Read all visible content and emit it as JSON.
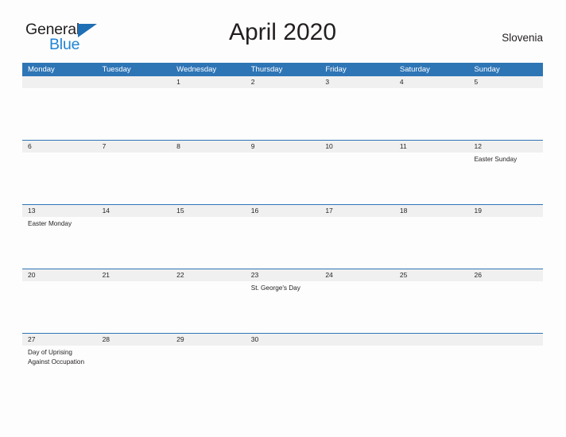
{
  "brand": {
    "name_part1": "General",
    "name_part2": "Blue",
    "flag_icon": "blue-flag-triangle",
    "color_dark": "#231f20",
    "color_blue": "#1f84d6"
  },
  "header": {
    "title": "April 2020",
    "country": "Slovenia"
  },
  "theme": {
    "header_blue": "#2e75b6",
    "number_band_gray": "#f0f0f0",
    "page_background": "#fdfdfd",
    "text": "#231f20"
  },
  "calendar": {
    "month": "April",
    "year": "2020",
    "weekday_headers": [
      "Monday",
      "Tuesday",
      "Wednesday",
      "Thursday",
      "Friday",
      "Saturday",
      "Sunday"
    ],
    "weeks": [
      {
        "days": [
          {
            "number": "",
            "event": ""
          },
          {
            "number": "",
            "event": ""
          },
          {
            "number": "1",
            "event": ""
          },
          {
            "number": "2",
            "event": ""
          },
          {
            "number": "3",
            "event": ""
          },
          {
            "number": "4",
            "event": ""
          },
          {
            "number": "5",
            "event": ""
          }
        ]
      },
      {
        "days": [
          {
            "number": "6",
            "event": ""
          },
          {
            "number": "7",
            "event": ""
          },
          {
            "number": "8",
            "event": ""
          },
          {
            "number": "9",
            "event": ""
          },
          {
            "number": "10",
            "event": ""
          },
          {
            "number": "11",
            "event": ""
          },
          {
            "number": "12",
            "event": "Easter Sunday"
          }
        ]
      },
      {
        "days": [
          {
            "number": "13",
            "event": "Easter Monday"
          },
          {
            "number": "14",
            "event": ""
          },
          {
            "number": "15",
            "event": ""
          },
          {
            "number": "16",
            "event": ""
          },
          {
            "number": "17",
            "event": ""
          },
          {
            "number": "18",
            "event": ""
          },
          {
            "number": "19",
            "event": ""
          }
        ]
      },
      {
        "days": [
          {
            "number": "20",
            "event": ""
          },
          {
            "number": "21",
            "event": ""
          },
          {
            "number": "22",
            "event": ""
          },
          {
            "number": "23",
            "event": "St. George's Day"
          },
          {
            "number": "24",
            "event": ""
          },
          {
            "number": "25",
            "event": ""
          },
          {
            "number": "26",
            "event": ""
          }
        ]
      },
      {
        "days": [
          {
            "number": "27",
            "event": "Day of Uprising\nAgainst Occupation"
          },
          {
            "number": "28",
            "event": ""
          },
          {
            "number": "29",
            "event": ""
          },
          {
            "number": "30",
            "event": ""
          },
          {
            "number": "",
            "event": ""
          },
          {
            "number": "",
            "event": ""
          },
          {
            "number": "",
            "event": ""
          }
        ]
      }
    ]
  }
}
